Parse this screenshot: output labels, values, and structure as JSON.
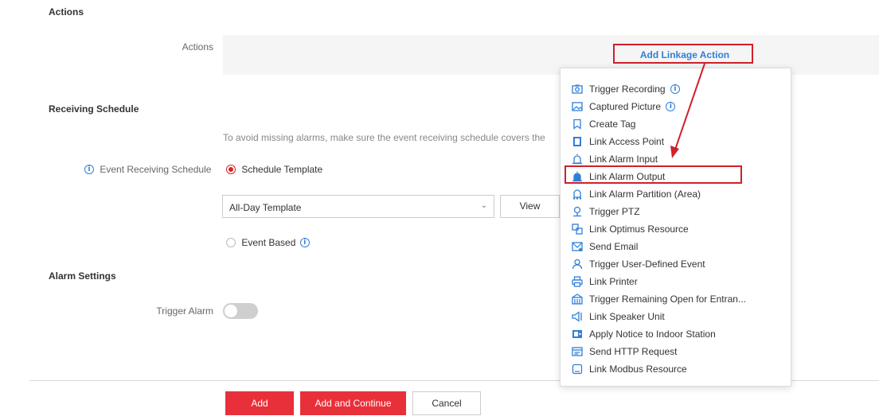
{
  "actions_section": {
    "title": "Actions",
    "row_label": "Actions",
    "add_linkage_label": "Add Linkage Action"
  },
  "receiving_schedule": {
    "title": "Receiving Schedule",
    "hint": "To avoid missing alarms, make sure the event receiving schedule covers the",
    "field_label": "Event Receiving Schedule",
    "option_template": "Schedule Template",
    "template_value": "All-Day Template",
    "view_label": "View",
    "option_event": "Event Based"
  },
  "alarm_settings": {
    "title": "Alarm Settings",
    "trigger_label": "Trigger Alarm"
  },
  "footer": {
    "add_label": "Add",
    "add_continue_label": "Add and Continue",
    "cancel_label": "Cancel"
  },
  "menu": {
    "items": [
      {
        "label": "Trigger Recording",
        "icon": "camera-icon",
        "info": true
      },
      {
        "label": "Captured Picture",
        "icon": "picture-icon",
        "info": true
      },
      {
        "label": "Create Tag",
        "icon": "bookmark-icon",
        "info": false
      },
      {
        "label": "Link Access Point",
        "icon": "door-icon",
        "info": false
      },
      {
        "label": "Link Alarm Input",
        "icon": "alarm-input-icon",
        "info": false
      },
      {
        "label": "Link Alarm Output",
        "icon": "alarm-output-icon",
        "info": false
      },
      {
        "label": "Link Alarm Partition (Area)",
        "icon": "alarm-partition-icon",
        "info": false
      },
      {
        "label": "Trigger PTZ",
        "icon": "ptz-icon",
        "info": false
      },
      {
        "label": "Link Optimus Resource",
        "icon": "resource-icon",
        "info": false
      },
      {
        "label": "Send Email",
        "icon": "email-icon",
        "info": false
      },
      {
        "label": "Trigger User-Defined Event",
        "icon": "user-icon",
        "info": false
      },
      {
        "label": "Link Printer",
        "icon": "printer-icon",
        "info": false
      },
      {
        "label": "Trigger Remaining Open for Entran...",
        "icon": "gate-icon",
        "info": false
      },
      {
        "label": "Link Speaker Unit",
        "icon": "speaker-icon",
        "info": false
      },
      {
        "label": "Apply Notice to Indoor Station",
        "icon": "notice-icon",
        "info": false
      },
      {
        "label": "Send HTTP Request",
        "icon": "http-icon",
        "info": false
      },
      {
        "label": "Link Modbus Resource",
        "icon": "modbus-icon",
        "info": false
      }
    ]
  },
  "colors": {
    "accent_red": "#e8303a",
    "link_blue": "#2f7fd8",
    "annotation_red": "#d0202a"
  }
}
